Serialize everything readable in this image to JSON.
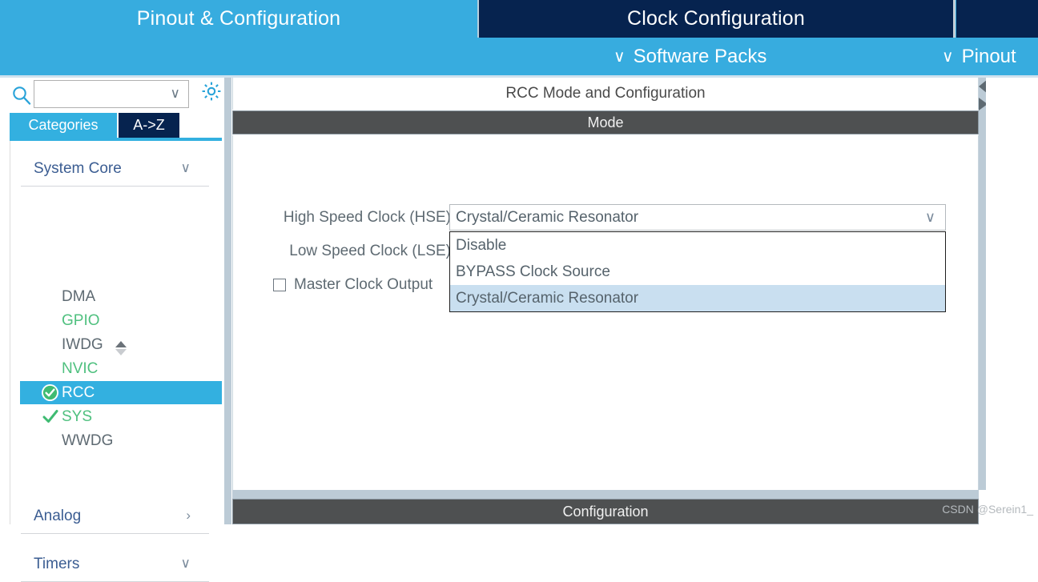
{
  "topbar": {
    "tabs": [
      {
        "label": "Pinout & Configuration",
        "active": false
      },
      {
        "label": "Clock Configuration",
        "active": true
      }
    ],
    "menu": [
      {
        "label": "Software Packs",
        "icon": "chevron-down-icon"
      },
      {
        "label": "Pinout",
        "icon": "chevron-down-icon"
      }
    ],
    "chevron": "∨"
  },
  "sidebar": {
    "search": {
      "value": "",
      "placeholder": "",
      "icon": "search-icon",
      "chevron": "∨"
    },
    "gear_icon": "gear-icon",
    "view_tabs": [
      {
        "label": "Categories",
        "active": true
      },
      {
        "label": "A->Z",
        "active": false
      }
    ],
    "categories": [
      {
        "label": "System Core",
        "expanded": true,
        "arrow": "∨"
      },
      {
        "label": "Analog",
        "expanded": false,
        "arrow": "›"
      },
      {
        "label": "Timers",
        "expanded": true,
        "arrow": "∨"
      }
    ],
    "peripherals": [
      {
        "label": "DMA",
        "state": "none",
        "selected": false
      },
      {
        "label": "GPIO",
        "state": "green",
        "selected": false
      },
      {
        "label": "IWDG",
        "state": "none",
        "selected": false
      },
      {
        "label": "NVIC",
        "state": "green",
        "selected": false
      },
      {
        "label": "RCC",
        "state": "badge",
        "selected": true
      },
      {
        "label": "SYS",
        "state": "check",
        "selected": false
      },
      {
        "label": "WWDG",
        "state": "none",
        "selected": false
      }
    ]
  },
  "main": {
    "panel_title": "RCC Mode and Configuration",
    "mode_header": "Mode",
    "config_header": "Configuration",
    "fields": {
      "hse_label": "High Speed Clock (HSE)",
      "lse_label": "Low Speed Clock (LSE)",
      "mco_label": "Master Clock Output",
      "mco_checked": false
    },
    "hse_combo": {
      "value": "Crystal/Ceramic Resonator",
      "chevron": "∨",
      "open": true,
      "options": [
        {
          "label": "Disable",
          "highlighted": false
        },
        {
          "label": "BYPASS Clock Source",
          "highlighted": false
        },
        {
          "label": "Crystal/Ceramic Resonator",
          "highlighted": true
        }
      ]
    },
    "collapse_left_icon": "triangle-left-icon",
    "collapse_right_icon": "triangle-right-icon"
  },
  "watermark": "CSDN @Serein1_",
  "colors": {
    "accent_blue": "#37acdf",
    "dark_navy": "#06234f",
    "panel_gray": "#4e5051",
    "highlight": "#c9dff0",
    "green": "#4fc07f"
  }
}
